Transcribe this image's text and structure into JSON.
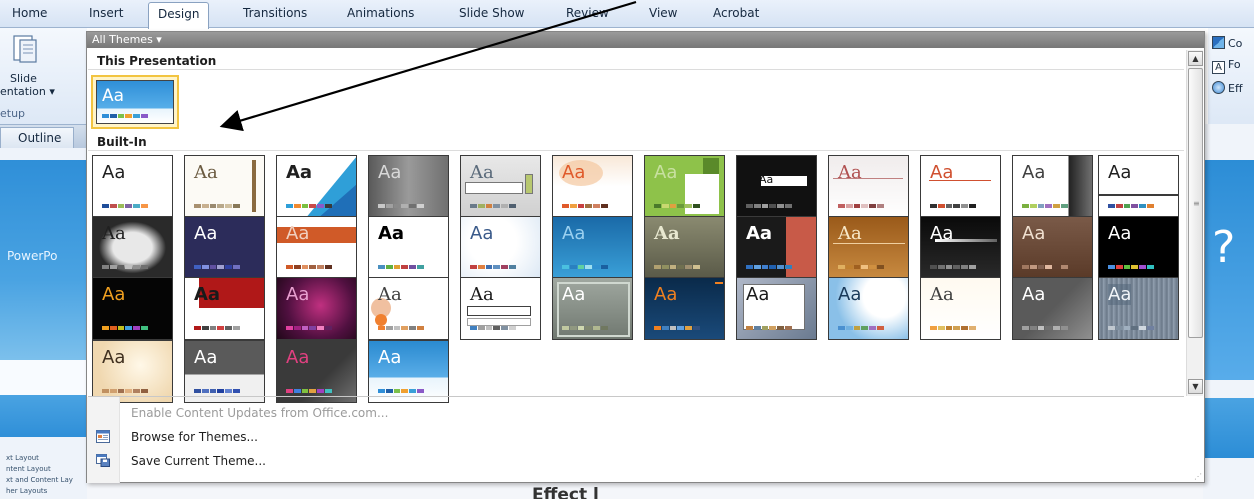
{
  "ribbon": {
    "tabs": [
      "Home",
      "Insert",
      "Design",
      "Transitions",
      "Animations",
      "Slide Show",
      "Review",
      "View",
      "Acrobat"
    ],
    "active_tab": "Design"
  },
  "left_pane": {
    "slide_label": "Slide",
    "orientation_label": "entation ▾",
    "group_label": "etup",
    "outline_tab": "Outline",
    "thumb_text": "PowerPo",
    "layouts": [
      "xt Layout",
      "ntent Layout",
      "xt and Content Lay",
      "her Layouts"
    ]
  },
  "right_pane": {
    "colors": "Co",
    "fonts": "Fo",
    "effects": "Eff",
    "question_mark": "?"
  },
  "gallery": {
    "header": "All Themes ▾",
    "this_presentation_label": "This Presentation",
    "built_in_label": "Built-In",
    "theme_text": "Aa",
    "themes_count_visible": 41
  },
  "menu": {
    "enable_updates": "Enable Content Updates from Office.com...",
    "browse": "Browse for Themes...",
    "save": "Save Current Theme..."
  },
  "slide_bottom_text": "Effect     l"
}
